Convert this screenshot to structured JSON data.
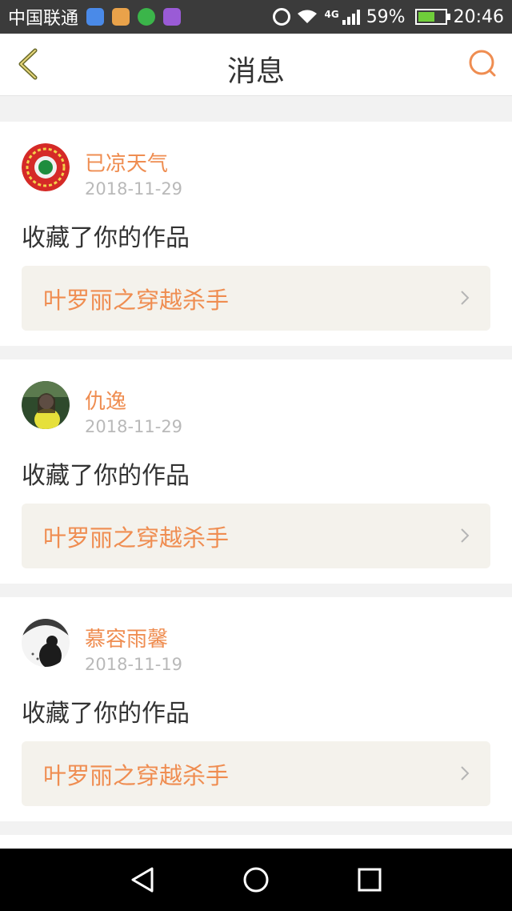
{
  "status_bar": {
    "carrier": "中国联通",
    "network": "4G",
    "battery": "59%",
    "time": "20:46",
    "colors": {
      "background": "#3b3b3b",
      "battery_fill": "#6fce3a"
    }
  },
  "header": {
    "title": "消息",
    "back_icon": "chevron-left-icon",
    "search_icon": "search-icon",
    "accent_color": "#ef8d51"
  },
  "messages": [
    {
      "user": "已凉天气",
      "date": "2018-11-29",
      "action": "收藏了你的作品",
      "work": "叶罗丽之穿越杀手",
      "avatar": "avatar-red-pattern"
    },
    {
      "user": "仇逸",
      "date": "2018-11-29",
      "action": "收藏了你的作品",
      "work": "叶罗丽之穿越杀手",
      "avatar": "avatar-girl-photo"
    },
    {
      "user": "慕容雨馨",
      "date": "2018-11-19",
      "action": "收藏了你的作品",
      "work": "叶罗丽之穿越杀手",
      "avatar": "avatar-dark-silhouette"
    }
  ],
  "nav_bar": {
    "back": "back-triangle-icon",
    "home": "home-circle-icon",
    "recents": "recents-square-icon"
  }
}
